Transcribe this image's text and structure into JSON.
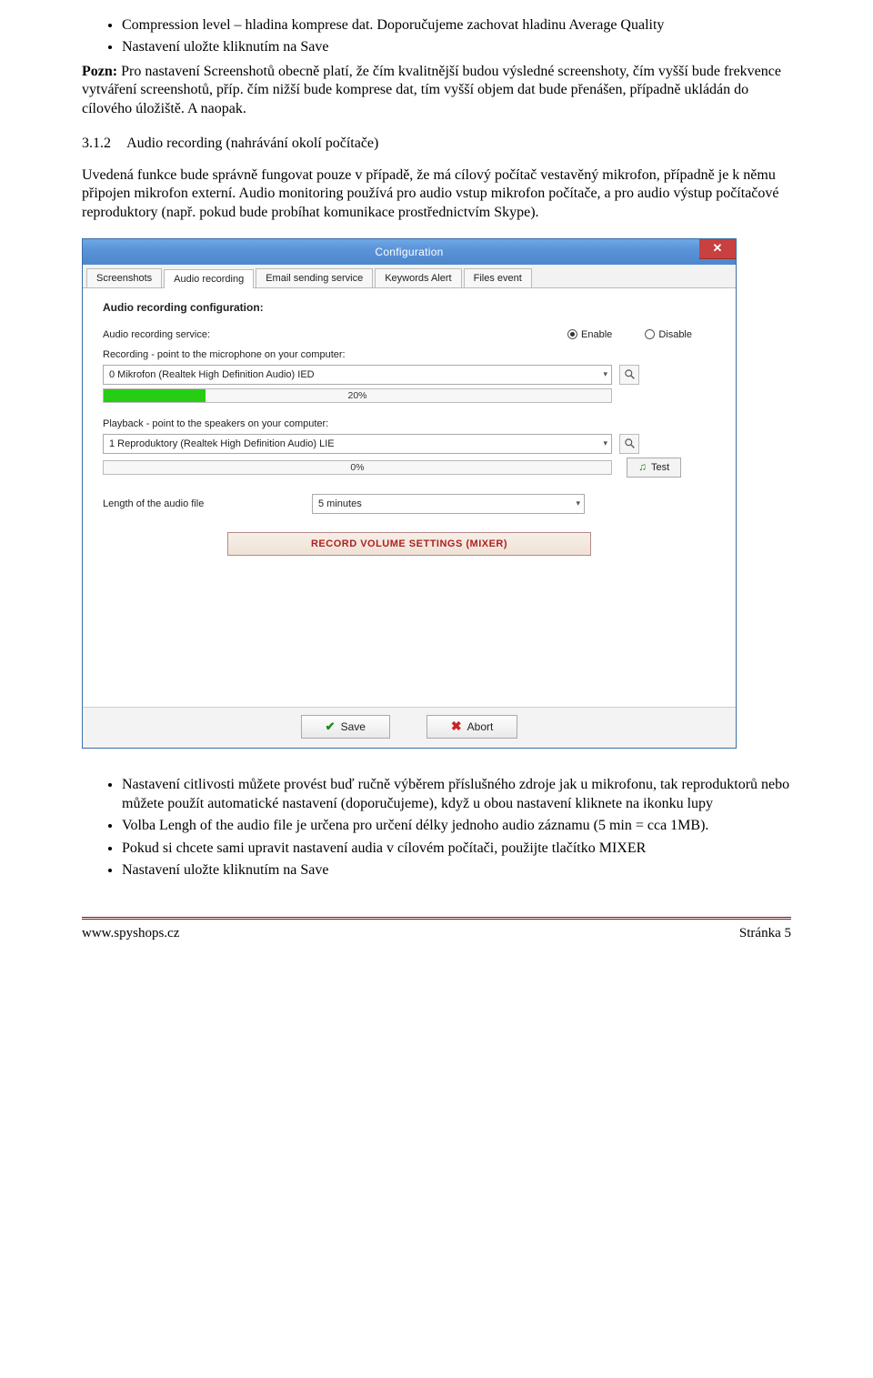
{
  "bullets_top": [
    "Compression level – hladina komprese dat. Doporučujeme zachovat hladinu Average Quality",
    "Nastavení uložte kliknutím na Save"
  ],
  "pozn_label": "Pozn:",
  "pozn_text": " Pro nastavení Screenshotů obecně platí, že čím kvalitnější budou výsledné screenshoty, čím vyšší bude frekvence vytváření screenshotů, příp. čím nižší bude komprese dat, tím vyšší objem dat bude přenášen, případně ukládán do cílového úložiště. A naopak.",
  "section_num": "3.1.2",
  "section_title": "Audio recording (nahrávání okolí počítače)",
  "para_1": "Uvedená funkce bude správně fungovat pouze v případě, že má cílový počítač vestavěný mikrofon, případně je k němu připojen mikrofon externí. Audio monitoring používá pro audio vstup mikrofon počítače, a pro audio výstup počítačové reproduktory (např. pokud bude probíhat komunikace prostřednictvím Skype).",
  "dialog": {
    "title": "Configuration",
    "tabs": [
      "Screenshots",
      "Audio recording",
      "Email sending service",
      "Keywords Alert",
      "Files event"
    ],
    "active_tab": 1,
    "group_title": "Audio recording configuration:",
    "service_label": "Audio recording service:",
    "enable": "Enable",
    "disable": "Disable",
    "rec_label": "Recording - point to the microphone on your computer:",
    "rec_device": "0  Mikrofon (Realtek High Definition Audio)  IED",
    "rec_pct": "20%",
    "play_label": "Playback - point to the speakers on your computer:",
    "play_device": "1  Reproduktory (Realtek High Definition Audio)  LIE",
    "play_pct": "0%",
    "test": "Test",
    "len_label": "Length of the audio file",
    "len_value": "5 minutes",
    "mixer": "RECORD VOLUME SETTINGS (MIXER)",
    "save": "Save",
    "abort": "Abort"
  },
  "bullets_bottom": [
    "Nastavení citlivosti můžete provést buď ručně výběrem příslušného zdroje jak u mikrofonu, tak reproduktorů nebo můžete použít automatické nastavení (doporučujeme), když u obou nastavení kliknete na ikonku lupy",
    "Volba Lengh of the audio file je určena pro určení délky jednoho audio záznamu (5 min = cca 1MB).",
    "Pokud si chcete sami upravit nastavení audia v cílovém počítači, použijte tlačítko MIXER",
    "Nastavení uložte kliknutím na Save"
  ],
  "footer_left": "www.spyshops.cz",
  "footer_right": "Stránka 5"
}
